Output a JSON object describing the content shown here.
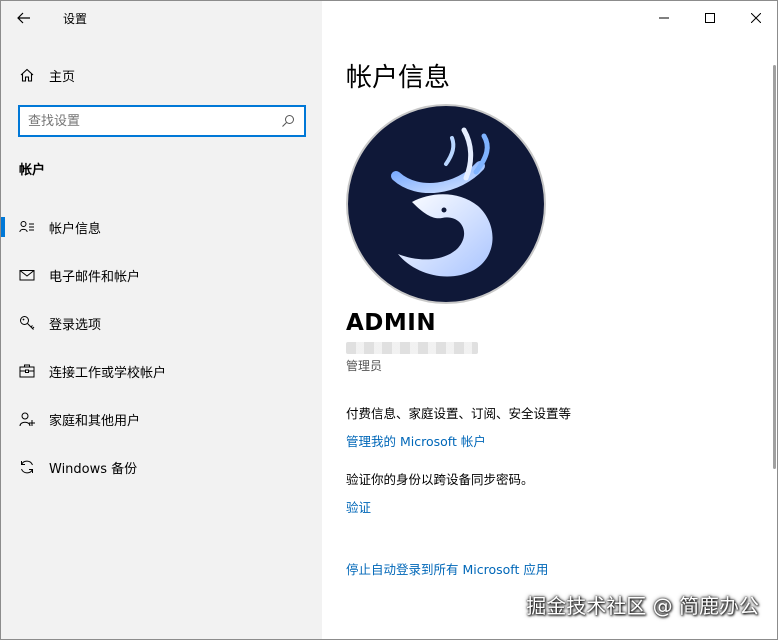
{
  "window": {
    "title": "设置"
  },
  "sidebar": {
    "home_label": "主页",
    "search_placeholder": "查找设置",
    "section_title": "帐户",
    "items": [
      {
        "label": "帐户信息",
        "icon": "account-info-icon"
      },
      {
        "label": "电子邮件和帐户",
        "icon": "email-icon"
      },
      {
        "label": "登录选项",
        "icon": "key-icon"
      },
      {
        "label": "连接工作或学校帐户",
        "icon": "briefcase-icon"
      },
      {
        "label": "家庭和其他用户",
        "icon": "add-user-icon"
      },
      {
        "label": "Windows 备份",
        "icon": "sync-icon"
      }
    ]
  },
  "main": {
    "page_title": "帐户信息",
    "user_name": "ADMIN",
    "role": "管理员",
    "info_text_1": "付费信息、家庭设置、订阅、安全设置等",
    "link_manage": "管理我的 Microsoft 帐户",
    "info_text_2": "验证你的身份以跨设备同步密码。",
    "link_verify": "验证",
    "link_stop_auto_login": "停止自动登录到所有 Microsoft 应用"
  },
  "watermark": "掘金技术社区 @ 简鹿办公",
  "colors": {
    "accent": "#0078d7",
    "link": "#0067b8",
    "sidebar_bg": "#f2f2f2",
    "avatar_bg": "#0f1838"
  }
}
